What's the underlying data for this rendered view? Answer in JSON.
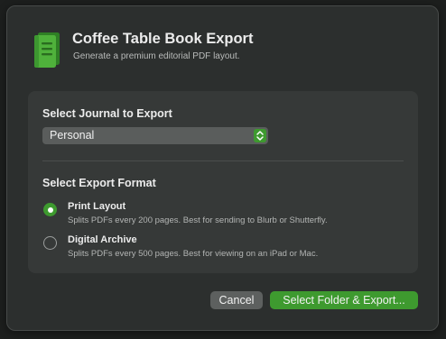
{
  "dialog": {
    "title": "Coffee Table Book Export",
    "subtitle": "Generate a premium editorial PDF layout.",
    "icon": "book-icon",
    "accent_color": "#3e9a2f"
  },
  "journal_section": {
    "label": "Select Journal to Export",
    "selected_journal": "Personal"
  },
  "format_section": {
    "label": "Select Export Format",
    "options": [
      {
        "title": "Print Layout",
        "description": "Splits PDFs every 200 pages. Best for sending to Blurb or Shutterfly.",
        "selected": true
      },
      {
        "title": "Digital Archive",
        "description": "Splits PDFs every 500 pages. Best for viewing on an iPad or Mac.",
        "selected": false
      }
    ]
  },
  "buttons": {
    "cancel_label": "Cancel",
    "export_label": "Select Folder & Export..."
  }
}
